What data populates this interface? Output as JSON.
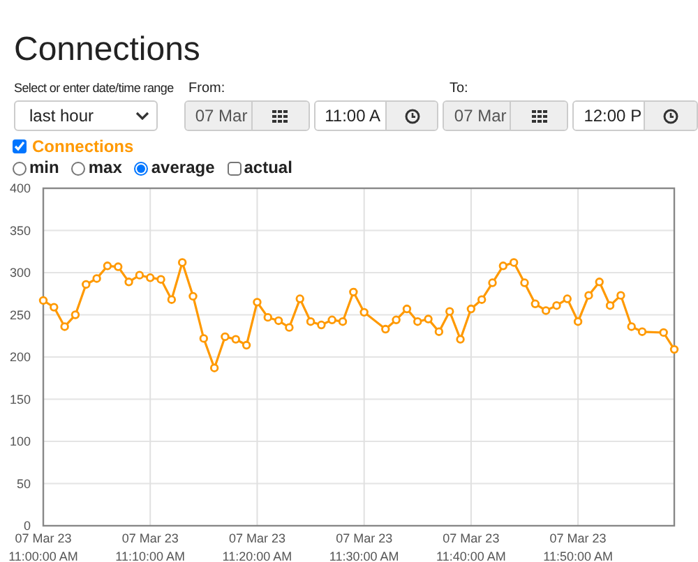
{
  "title": "Connections",
  "range": {
    "label": "Select or enter date/time range",
    "value": "last hour"
  },
  "from": {
    "label": "From:",
    "date": "07 Mar",
    "time": "11:00 A"
  },
  "to": {
    "label": "To:",
    "date": "07 Mar",
    "time": "12:00 P"
  },
  "series_toggle": {
    "checked": true
  },
  "modes": [
    {
      "label": "min",
      "kind": "radio",
      "selected": false
    },
    {
      "label": "max",
      "kind": "radio",
      "selected": false
    },
    {
      "label": "average",
      "kind": "radio",
      "selected": true
    },
    {
      "label": "actual",
      "kind": "checkbox",
      "selected": false
    }
  ],
  "chart_data": {
    "type": "line",
    "grid": true,
    "categories": [
      "07 Mar 23 11:00:00 AM",
      null,
      null,
      null,
      null,
      null,
      null,
      null,
      null,
      null,
      "07 Mar 23 11:10:00 AM",
      null,
      null,
      null,
      null,
      null,
      null,
      null,
      null,
      null,
      "07 Mar 23 11:20:00 AM",
      null,
      null,
      null,
      null,
      null,
      null,
      null,
      null,
      null,
      "07 Mar 23 11:30:00 AM",
      null,
      null,
      null,
      null,
      null,
      null,
      null,
      null,
      null,
      "07 Mar 23 11:40:00 AM",
      null,
      null,
      null,
      null,
      null,
      null,
      null,
      null,
      null,
      "07 Mar 23 11:50:00 AM",
      null,
      null,
      null,
      null,
      null,
      null,
      null,
      null,
      null
    ],
    "series": [
      {
        "name": "Connections",
        "color": "#ff9900",
        "marker": true,
        "values": [
          267,
          259,
          236,
          250,
          286,
          293,
          308,
          307,
          289,
          297,
          294,
          292,
          268,
          312,
          272,
          222,
          187,
          224,
          221,
          214,
          265,
          247,
          243,
          235,
          269,
          242,
          238,
          244,
          242,
          277,
          253,
          null,
          233,
          244,
          257,
          242,
          245,
          230,
          254,
          221,
          257,
          268,
          288,
          308,
          312,
          288,
          263,
          255,
          261,
          269,
          242,
          273,
          289,
          261,
          273,
          236,
          230,
          null,
          229,
          209
        ]
      }
    ],
    "ylim": [
      0,
      400
    ],
    "yticks": [
      0,
      50,
      100,
      150,
      200,
      250,
      300,
      350,
      400
    ]
  }
}
